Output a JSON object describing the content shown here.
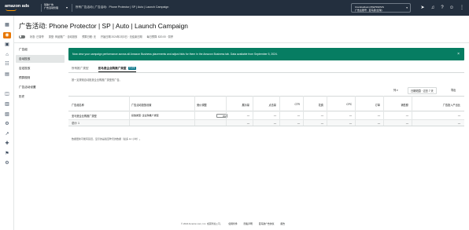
{
  "topbar": {
    "logo_text": "amazon ads",
    "account_switch": [
      "赞助广告",
      "广告活动管理"
    ],
    "breadcrumb": "所有广告活动  |  广告活动：Phone Protector | SP | Auto | Launch Campaign",
    "account_box": [
      "Crambodkunnr/SW/SW/S/S",
      "广告主账号 · 亚马逊(全球)"
    ],
    "icons": [
      "send-icon",
      "bell-icon",
      "help-icon",
      "user-icon",
      "grid-icon"
    ]
  },
  "rail_icons": [
    "grid-icon",
    "campaigns-icon",
    "box-icon",
    "store-icon",
    "table-icon",
    "image-icon",
    "layers-icon",
    "chart-icon",
    "calendar-icon",
    "settings-icon",
    "link-icon",
    "plus-icon",
    "target-icon",
    "tools-icon"
  ],
  "header": {
    "title_prefix": "广告活动: ",
    "title": "Phone Protector | SP | Auto | Launch Campaign",
    "status": "状态: 已暂停",
    "type": "类型: 商品推广 · 自动投放",
    "schedule": "预算日程: 无",
    "dates": "开始日期 2024年2月3日 · 无结束日期",
    "budget": "每日预算: $20.00 · 暂停"
  },
  "subnav": [
    "广告组",
    "自动投放",
    "否定投放",
    "预算规则",
    "广告活动设置",
    "历史"
  ],
  "subnav_active": 1,
  "notice": {
    "text": "Now view your campaign performance across all Amazon Business placements and adjust bids for them in the Amazon Business tab. Data available from September 5, 2024.",
    "close": "×"
  },
  "tabs": [
    {
      "label": "所有推广类型",
      "badge": ""
    },
    {
      "label": "亚马逊企业购推广类型",
      "badge": "新功能"
    }
  ],
  "description": "按一定规则自动投放企业购推广类型的广告。",
  "toolbar": {
    "columns": "列",
    "date_label": "日期范围 · 过去 7 天",
    "export": "导出"
  },
  "table": {
    "headers": [
      "广告组名称",
      "广告活动投放设置",
      "竞价调整",
      "展示量",
      "点击量",
      "CTR",
      "花费",
      "CPC",
      "订单",
      "销售额",
      "广告投入产出比"
    ],
    "rows": [
      [
        "亚马逊企业购推广类型",
        "投放类型: 企业购推广类型",
        "0%",
        "—",
        "—",
        "—",
        "—",
        "—",
        "—",
        "—",
        "—"
      ]
    ],
    "footer": [
      "总计: 1",
      "",
      "",
      "—",
      "—",
      "—",
      "—",
      "—",
      "—",
      "—",
      "—"
    ]
  },
  "note": "数据更新可能有延迟，显示的是截至昨天的数据（最多 12 小时）。",
  "footer": {
    "copyright": "© 2024 Amazon.com, Inc. 或其附属公司。",
    "links": [
      "使用条件",
      "隐私声明",
      "亚马逊广告协议",
      "报告"
    ]
  }
}
